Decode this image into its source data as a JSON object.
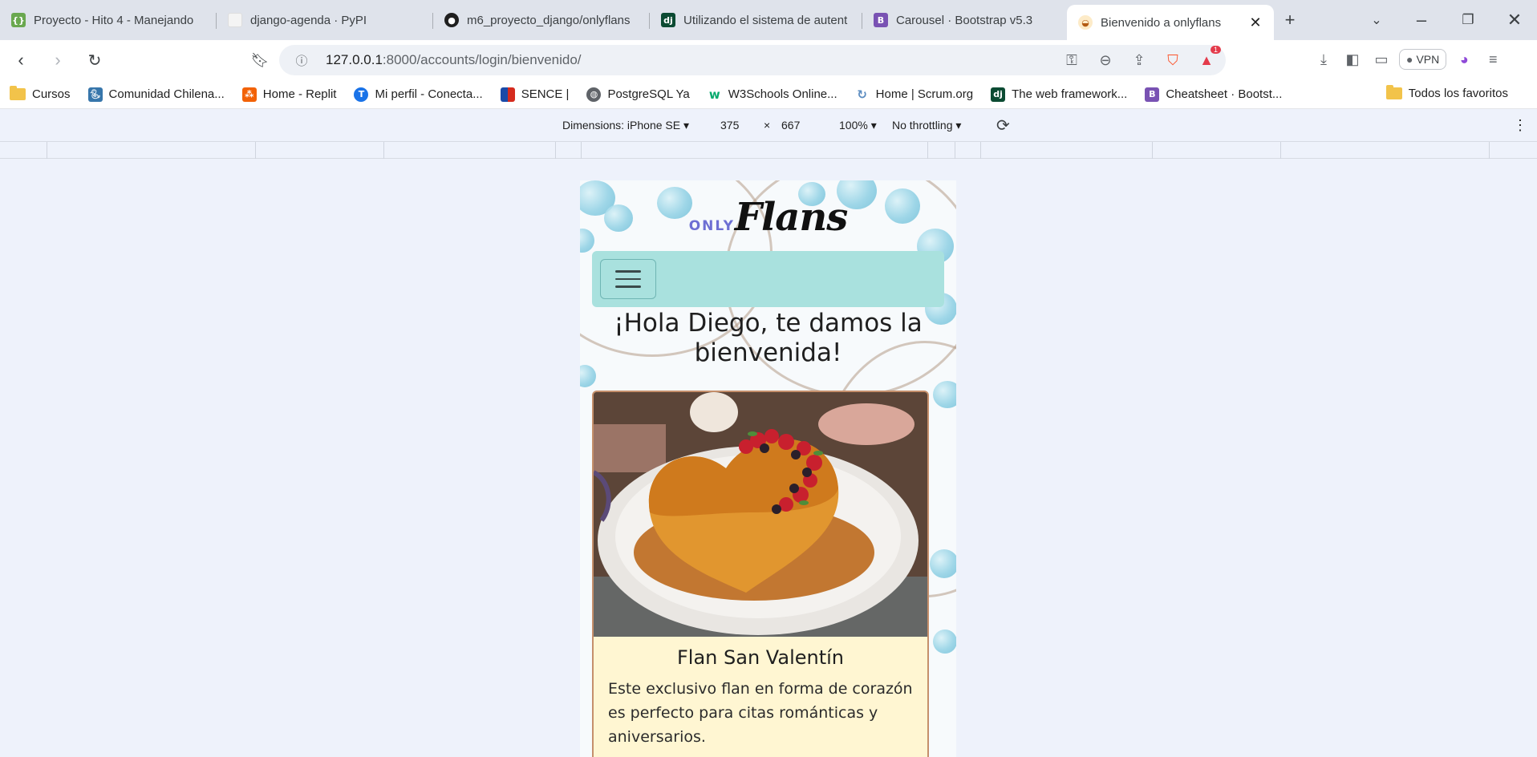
{
  "tabs": [
    {
      "title": "Proyecto - Hito 4 - Manejando",
      "icon": "replit-icon",
      "color": "#6aa84f"
    },
    {
      "title": "django-agenda · PyPI",
      "icon": "pypi-icon",
      "color": "#ffffff"
    },
    {
      "title": "m6_proyecto_django/onlyflans",
      "icon": "github-icon",
      "color": "#1f1f1f"
    },
    {
      "title": "Utilizando el sistema de autent",
      "icon": "django-icon",
      "color": "#0c4b33"
    },
    {
      "title": "Carousel · Bootstrap v5.3",
      "icon": "bootstrap-icon",
      "color": "#7952b3"
    },
    {
      "title": "Bienvenido a onlyflans",
      "icon": "flan-icon",
      "color": "#e1a43b"
    }
  ],
  "address": {
    "host": "127.0.0.1",
    "rest": ":8000/accounts/login/bienvenido/"
  },
  "vpn_label": "VPN",
  "notif_count": "1",
  "bookmarks": [
    {
      "label": "Cursos",
      "type": "folder"
    },
    {
      "label": "Comunidad Chilena...",
      "color": "#3776ab"
    },
    {
      "label": "Home - Replit",
      "color": "#f26207"
    },
    {
      "label": "Mi perfil - Conecta...",
      "color": "#1a73e8"
    },
    {
      "label": "SENCE |",
      "color": "#d52b1e"
    },
    {
      "label": "PostgreSQL Ya",
      "color": "#5f6368"
    },
    {
      "label": "W3Schools Online...",
      "color": "#04aa6d"
    },
    {
      "label": "Home | Scrum.org",
      "color": "#5b8cc0"
    },
    {
      "label": "The web framework...",
      "color": "#0c4b33"
    },
    {
      "label": "Cheatsheet · Bootst...",
      "color": "#7952b3"
    }
  ],
  "bookmarks_all": "Todos los favoritos",
  "devtools": {
    "dimensions_label": "Dimensions: iPhone SE",
    "width": "375",
    "times": "×",
    "height": "667",
    "zoom": "100%",
    "throttle": "No throttling"
  },
  "page": {
    "logo_only": "ONLY",
    "logo_flans": "Flans",
    "welcome": "¡Hola Diego, te damos la bienvenida!",
    "card_title": "Flan San Valentín",
    "card_text": "Este exclusivo flan en forma de corazón es perfecto para citas románticas y aniversarios."
  }
}
